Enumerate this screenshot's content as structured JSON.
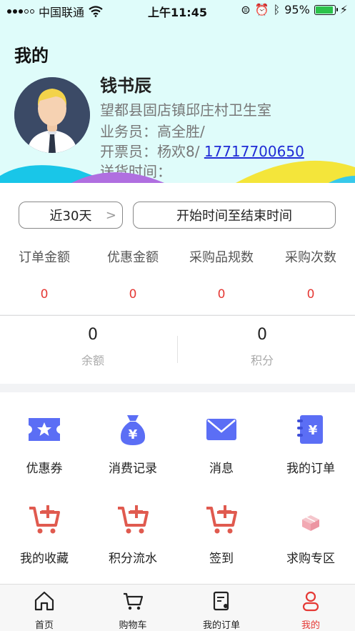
{
  "status_bar": {
    "carrier": "中国联通",
    "time": "上午11:45",
    "battery": "95%",
    "battery_level": 0.95
  },
  "header": {
    "title": "我的",
    "user_name": "钱书辰",
    "clinic": "望都县固店镇邱庄村卫生室",
    "salesman": "业务员：高全胜/",
    "invoicer_prefix": "开票员：杨欢8/",
    "invoicer_phone": "17717700650",
    "delivery_time": "送货时间："
  },
  "date_filter": {
    "range_label": "近30天",
    "range_chevron": ">",
    "custom_label": "开始时间至结束时间"
  },
  "stats": [
    {
      "label": "订单金额",
      "value": "0"
    },
    {
      "label": "优惠金额",
      "value": "0"
    },
    {
      "label": "采购品规数",
      "value": "0"
    },
    {
      "label": "采购次数",
      "value": "0"
    }
  ],
  "balance": {
    "balance_value": "0",
    "balance_label": "余额",
    "points_value": "0",
    "points_label": "积分"
  },
  "menu": [
    {
      "label": "优惠券",
      "icon": "coupon-icon"
    },
    {
      "label": "消费记录",
      "icon": "money-bag-icon"
    },
    {
      "label": "消息",
      "icon": "envelope-icon"
    },
    {
      "label": "我的订单",
      "icon": "order-book-icon"
    },
    {
      "label": "我的收藏",
      "icon": "cart-add-icon"
    },
    {
      "label": "积分流水",
      "icon": "cart-add-icon"
    },
    {
      "label": "签到",
      "icon": "cart-add-icon"
    },
    {
      "label": "求购专区",
      "icon": "gift-box-icon"
    }
  ],
  "tabbar": [
    {
      "label": "首页",
      "icon": "home-icon",
      "active": false
    },
    {
      "label": "购物车",
      "icon": "cart-icon",
      "active": false
    },
    {
      "label": "我的订单",
      "icon": "order-icon",
      "active": false
    },
    {
      "label": "我的",
      "icon": "user-icon",
      "active": true
    }
  ],
  "colors": {
    "accent_red": "#e53935",
    "header_bg": "#dffcfa",
    "icon_blue": "#5b6ef5",
    "link_blue": "#1f2bd6"
  }
}
